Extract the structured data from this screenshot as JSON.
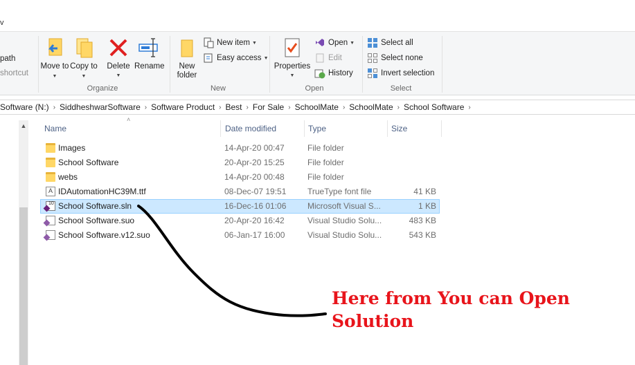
{
  "window": {
    "top_fragment": "v"
  },
  "ribbon": {
    "clipboard_partial": {
      "path_label": "path",
      "shortcut_label": "shortcut"
    },
    "organize": {
      "label": "Organize",
      "move_to": "Move to",
      "copy_to": "Copy to",
      "delete": "Delete",
      "rename": "Rename"
    },
    "new": {
      "label": "New",
      "new_folder": "New folder",
      "new_item": "New item",
      "easy_access": "Easy access"
    },
    "open": {
      "label": "Open",
      "properties": "Properties",
      "open": "Open",
      "edit": "Edit",
      "history": "History"
    },
    "select": {
      "label": "Select",
      "select_all": "Select all",
      "select_none": "Select none",
      "invert_selection": "Invert selection"
    }
  },
  "address": {
    "crumbs": [
      "Software (N:)",
      "SiddheshwarSoftware",
      "Software Product",
      "Best",
      "For Sale",
      "SchoolMate",
      "SchoolMate",
      "School Software"
    ]
  },
  "columns": {
    "name": "Name",
    "date": "Date modified",
    "type": "Type",
    "size": "Size"
  },
  "files": [
    {
      "name": "Images",
      "date": "14-Apr-20 00:47",
      "type": "File folder",
      "size": "",
      "icon": "folder-icon"
    },
    {
      "name": "School Software",
      "date": "20-Apr-20 15:25",
      "type": "File folder",
      "size": "",
      "icon": "folder-icon"
    },
    {
      "name": "webs",
      "date": "14-Apr-20 00:48",
      "type": "File folder",
      "size": "",
      "icon": "folder-icon"
    },
    {
      "name": "IDAutomationHC39M.ttf",
      "date": "08-Dec-07 19:51",
      "type": "TrueType font file",
      "size": "41 KB",
      "icon": "font-file-icon"
    },
    {
      "name": "School Software.sln",
      "date": "16-Dec-16 01:06",
      "type": "Microsoft Visual S...",
      "size": "1 KB",
      "icon": "visual-studio-solution-icon"
    },
    {
      "name": "School Software.suo",
      "date": "20-Apr-20 16:42",
      "type": "Visual Studio Solu...",
      "size": "483 KB",
      "icon": "visual-studio-options-icon"
    },
    {
      "name": "School Software.v12.suo",
      "date": "06-Jan-17 16:00",
      "type": "Visual Studio Solu...",
      "size": "543 KB",
      "icon": "visual-studio-options-icon"
    }
  ],
  "annotation": {
    "line1": "Here from You can Open",
    "line2": "Solution",
    "color": "#e8141b"
  },
  "colors": {
    "selected_row": "#cce8ff",
    "header_text": "#4d6185"
  }
}
